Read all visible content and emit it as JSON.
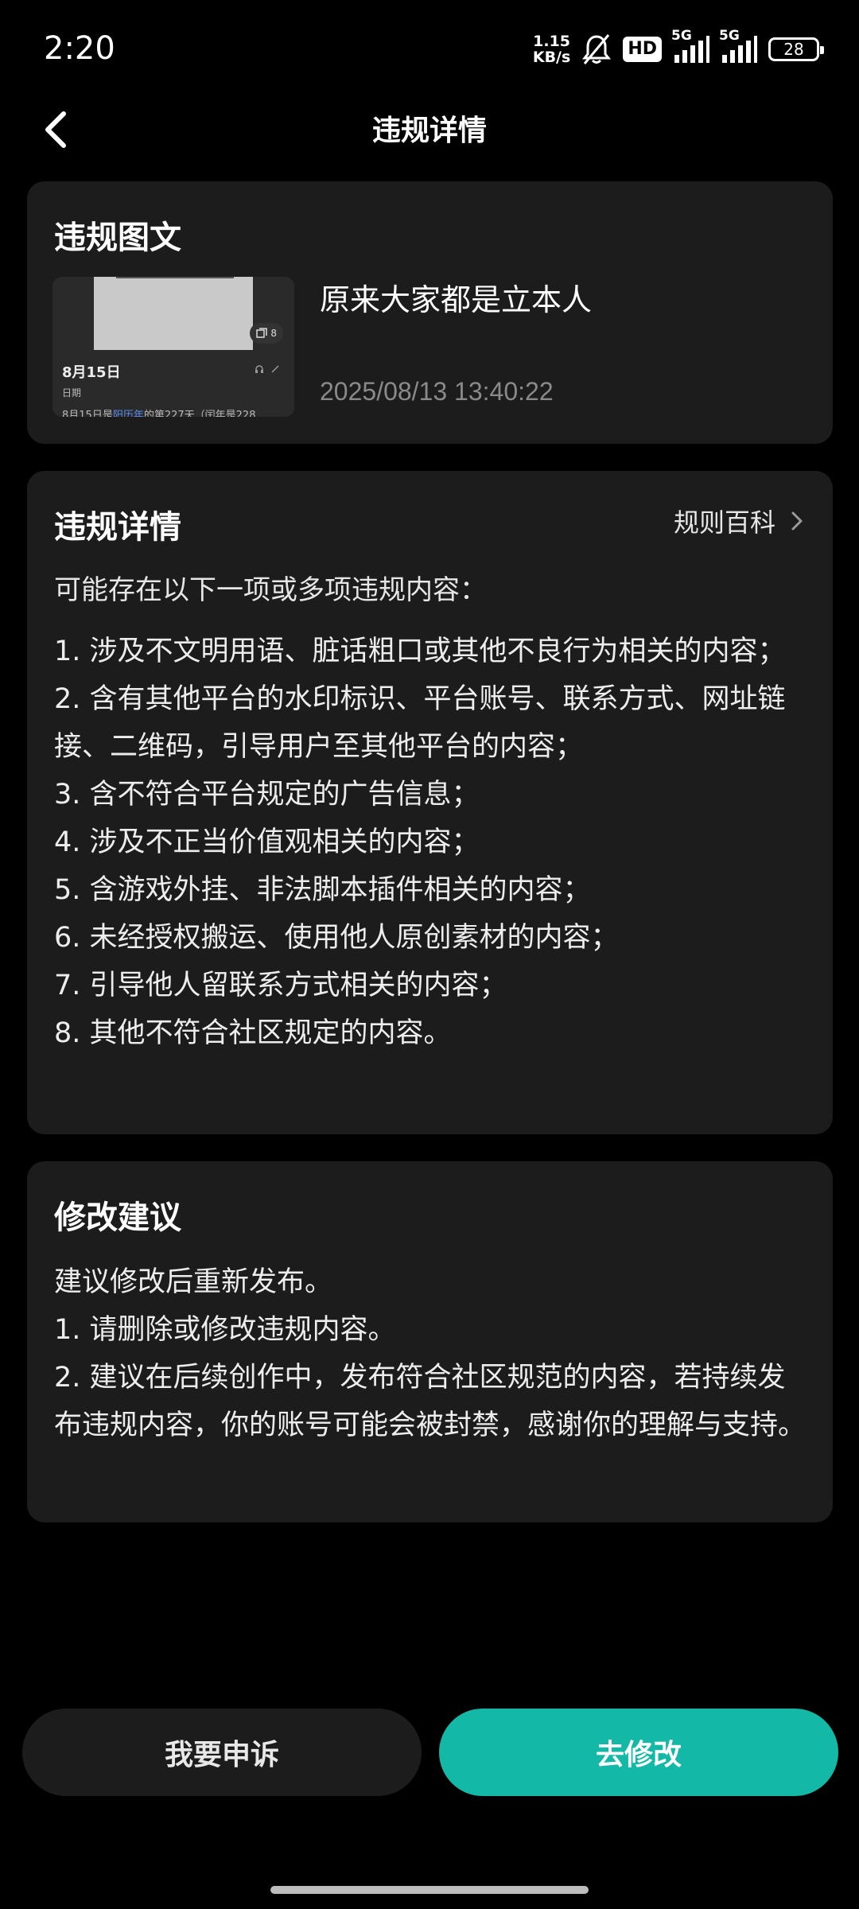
{
  "status_bar": {
    "time": "2:20",
    "net_speed_value": "1.15",
    "net_speed_unit": "KB/s",
    "hd_label": "HD",
    "signal1_label": "5G",
    "signal2_label": "5G",
    "battery": "28"
  },
  "nav": {
    "title": "违规详情"
  },
  "violation_post": {
    "section_title": "违规图文",
    "post_title": "原来大家都是立本人",
    "post_time": "2025/08/13 13:40:22",
    "thumbnail": {
      "image_count": "8",
      "date": "8月15日",
      "sub": "日期",
      "line_prefix": "8月15日是",
      "line_highlight": "阳历年",
      "line_suffix": "的第227天（闰年是228"
    }
  },
  "details": {
    "section_title": "违规详情",
    "rules_link": "规则百科",
    "intro": "可能存在以下一项或多项违规内容：",
    "items": [
      "1. 涉及不文明用语、脏话粗口或其他不良行为相关的内容；",
      "2. 含有其他平台的水印标识、平台账号、联系方式、网址链接、二维码，引导用户至其他平台的内容；",
      "3. 含不符合平台规定的广告信息；",
      "4. 涉及不正当价值观相关的内容；",
      "5. 含游戏外挂、非法脚本插件相关的内容；",
      "6. 未经授权搬运、使用他人原创素材的内容；",
      "7. 引导他人留联系方式相关的内容；",
      "8. 其他不符合社区规定的内容。"
    ]
  },
  "suggestion": {
    "section_title": "修改建议",
    "lines": [
      "建议修改后重新发布。",
      "1. 请删除或修改违规内容。",
      "2. 建议在后续创作中，发布符合社区规范的内容，若持续发布违规内容，你的账号可能会被封禁，感谢你的理解与支持。"
    ]
  },
  "buttons": {
    "appeal": "我要申诉",
    "modify": "去修改"
  },
  "colors": {
    "accent": "#14b8a6",
    "card_bg": "#1c1c1c",
    "page_bg": "#000000"
  }
}
